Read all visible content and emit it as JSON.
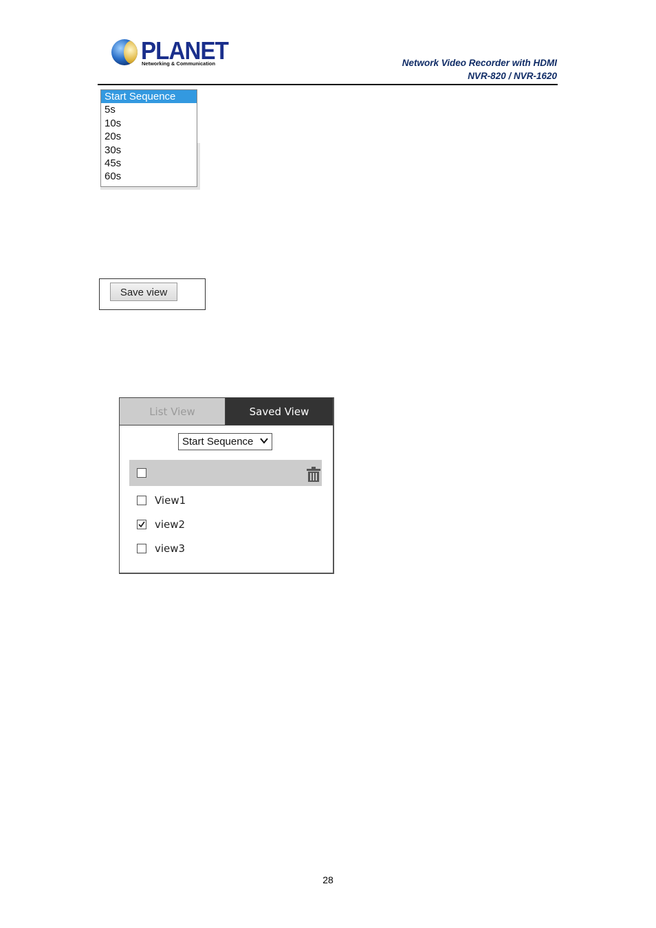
{
  "header": {
    "logo_text": "PLANET",
    "logo_subtitle": "Networking & Communication",
    "title_line1": "Network Video Recorder with HDMI",
    "title_line2": "NVR-820 / NVR-1620"
  },
  "dropdown": {
    "options": [
      {
        "label": "Start Sequence",
        "selected": true
      },
      {
        "label": "5s",
        "selected": false
      },
      {
        "label": "10s",
        "selected": false
      },
      {
        "label": "20s",
        "selected": false
      },
      {
        "label": "30s",
        "selected": false
      },
      {
        "label": "45s",
        "selected": false
      },
      {
        "label": "60s",
        "selected": false
      }
    ]
  },
  "save_view": {
    "button_label": "Save view"
  },
  "panel": {
    "tabs": [
      {
        "label": "List View",
        "active": false
      },
      {
        "label": "Saved View",
        "active": true
      }
    ],
    "sequence_select": {
      "value": "Start Sequence",
      "icon": "chevron-down-icon"
    },
    "select_all": {
      "checked": false,
      "delete_icon": "trash-icon"
    },
    "views": [
      {
        "label": "View1",
        "checked": false
      },
      {
        "label": "view2",
        "checked": true
      },
      {
        "label": "view3",
        "checked": false
      }
    ]
  },
  "footer": {
    "page_number": "28"
  },
  "colors": {
    "brand_blue": "#1a2f8c",
    "title_blue": "#102c66",
    "selection_blue": "#3399e0",
    "active_tab_bg": "#333333",
    "inactive_tab_bg": "#cccccc"
  }
}
